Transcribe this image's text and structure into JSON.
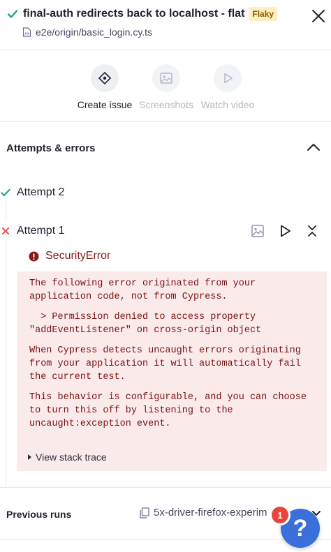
{
  "header": {
    "title": "final-auth redirects back to localhost - flat",
    "badge": "Flaky",
    "spec_path": "e2e/origin/basic_login.cy.ts"
  },
  "actions": [
    {
      "label": "Create issue",
      "icon": "diamond-icon",
      "enabled": true
    },
    {
      "label": "Screenshots",
      "icon": "image-icon",
      "enabled": false
    },
    {
      "label": "Watch video",
      "icon": "play-icon",
      "enabled": false
    }
  ],
  "attempts_section": {
    "title": "Attempts & errors"
  },
  "attempts": [
    {
      "label": "Attempt 2",
      "status": "passed"
    },
    {
      "label": "Attempt 1",
      "status": "failed"
    }
  ],
  "error": {
    "name": "SecurityError",
    "lines": [
      "The following error originated from your application code, not from Cypress.",
      "  > Permission denied to access property \"addEventListener\" on cross-origin object",
      "When Cypress detects uncaught errors originating from your application it will automatically fail the current test.",
      "This behavior is configurable, and you can choose to turn this off by listening to the uncaught:exception event."
    ],
    "stack_trace_label": "View stack trace"
  },
  "previous_runs": {
    "title": "Previous runs",
    "branch": "5x-driver-firefox-experim"
  },
  "help": {
    "symbol": "?",
    "notification_count": "1"
  },
  "colors": {
    "pass": "#1fa971",
    "fail": "#e05a5a",
    "error_bg": "#fbeaea",
    "error_text": "#7b1212",
    "fab": "#3b6fd9"
  }
}
